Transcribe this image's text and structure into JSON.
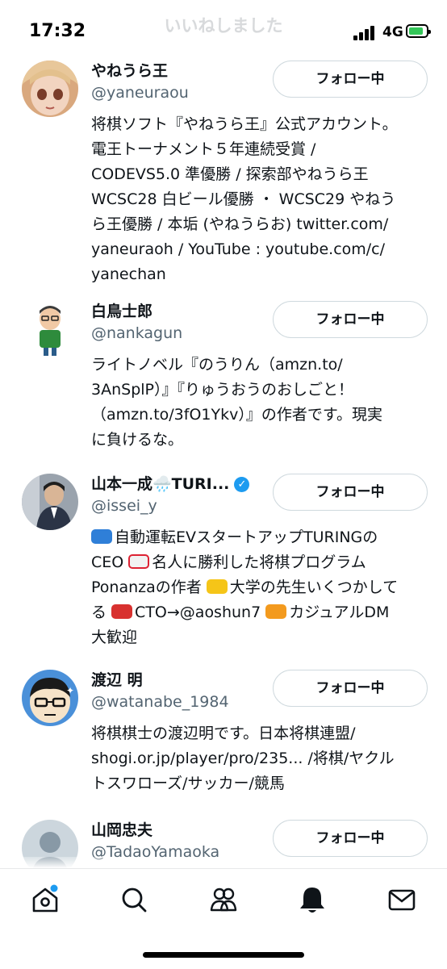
{
  "status": {
    "time": "17:32",
    "network": "4G"
  },
  "header": {
    "title": "いいねしました",
    "subtitle": ""
  },
  "follow_label": "フォロー中",
  "users": [
    {
      "name": "やねうら王",
      "handle": "@yaneuraou",
      "bio": "将棋ソフト『やねうら王』公式アカウント。\n電王トーナメント５年連続受賞 /\nCODEVS5.0 準優勝 / 探索部やねうら王\nWCSC28 白ビール優勝 ・ WCSC29 やねう\nら王優勝 / 本垢 (やねうらお) twitter.com/\nyaneuraoh / YouTube : youtube.com/c/\nyanechan"
    },
    {
      "name": "白鳥士郎",
      "handle": "@nankagun",
      "bio": "ライトノベル『のうりん（amzn.to/\n3AnSplP）』『りゅうおうのおしごと！\n（amzn.to/3fO1Ykv）』の作者です。現実\nに負けるな。"
    },
    {
      "name": "山本一成🌧️TURI...",
      "handle": "@issei_y",
      "verified": true,
      "bio_lines": [
        [
          "🚙",
          "自動運転EVスタートアップTURINGの"
        ],
        [
          "",
          "CEO "
        ],
        [
          "🚑",
          "名人に勝利した将棋プログラム"
        ],
        [
          "",
          "Ponanzaの作者 "
        ],
        [
          "🚕",
          "大学の先生いくつかして"
        ],
        [
          "",
          "る "
        ],
        [
          "🚒",
          "CTO→@aoshun7 "
        ],
        [
          "🚚",
          "カジュアルDM"
        ],
        [
          "",
          "大歓迎"
        ]
      ]
    },
    {
      "name": "渡辺 明",
      "handle": "@watanabe_1984",
      "bio": "将棋棋士の渡辺明です。日本将棋連盟/\nshogi.or.jp/player/pro/235... /将棋/ヤクル\nトスワローズ/サッカー/競馬"
    },
    {
      "name": "山岡忠夫",
      "handle": "@TadaoYamaoka",
      "bio": ""
    }
  ],
  "tabs": [
    {
      "name": "home",
      "icon": "home-icon"
    },
    {
      "name": "search",
      "icon": "search-icon"
    },
    {
      "name": "communities",
      "icon": "communities-icon"
    },
    {
      "name": "notifications",
      "icon": "bell-icon"
    },
    {
      "name": "messages",
      "icon": "mail-icon"
    }
  ],
  "colors": {
    "accent": "#1d9bf0",
    "text": "#0f1419",
    "secondary": "#536471",
    "border": "#cfd9de"
  }
}
